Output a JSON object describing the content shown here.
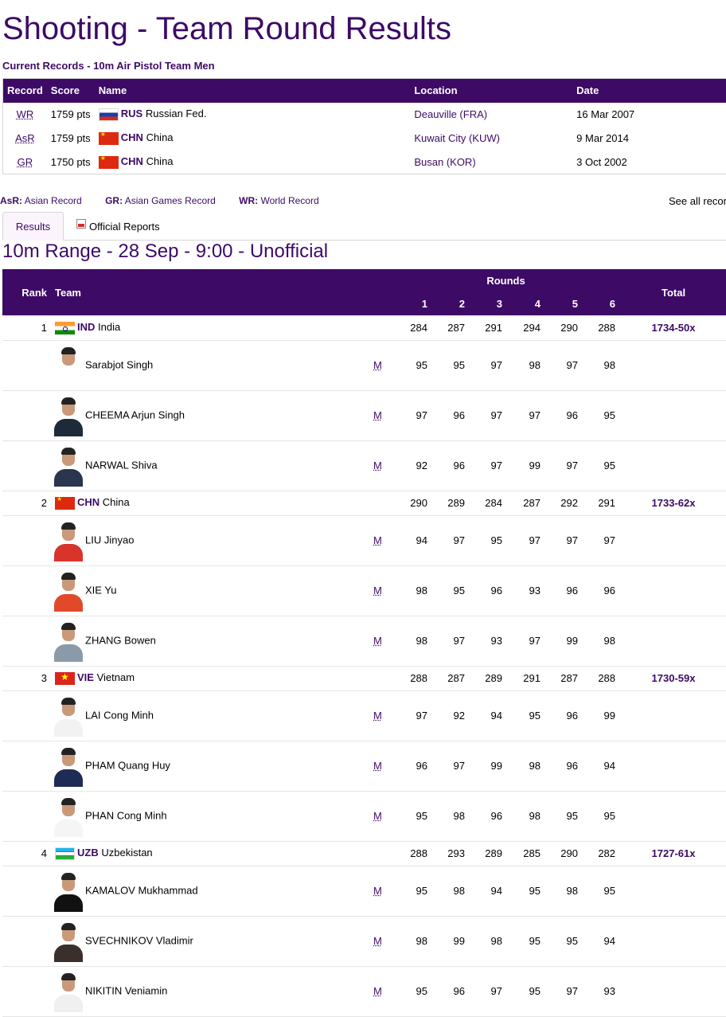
{
  "page_title": "Shooting - Team Round Results",
  "records": {
    "title": "Current Records - 10m Air Pistol Team Men",
    "headers": [
      "Record",
      "Score",
      "Name",
      "Location",
      "Date"
    ],
    "rows": [
      {
        "record": "WR",
        "score": "1759 pts",
        "noc": "RUS",
        "name": "Russian Fed.",
        "location": "Deauville (FRA)",
        "date": "16 Mar 2007"
      },
      {
        "record": "AsR",
        "score": "1759 pts",
        "noc": "CHN",
        "name": "China",
        "location": "Kuwait City (KUW)",
        "date": "9 Mar 2014"
      },
      {
        "record": "GR",
        "score": "1750 pts",
        "noc": "CHN",
        "name": "China",
        "location": "Busan (KOR)",
        "date": "3 Oct 2002"
      }
    ]
  },
  "legend": {
    "items": [
      {
        "code": "AsR:",
        "text": "Asian Record"
      },
      {
        "code": "GR:",
        "text": "Asian Games Record"
      },
      {
        "code": "WR:",
        "text": "World Record"
      }
    ],
    "see_all": "See all records"
  },
  "tabs": {
    "results": "Results",
    "reports": "Official Reports"
  },
  "range_title": "10m Range - 28 Sep - 9:00 - Unofficial",
  "results": {
    "headers": {
      "rank": "Rank",
      "team": "Team",
      "rounds": "Rounds",
      "total": "Total",
      "round_numbers": [
        "1",
        "2",
        "3",
        "4",
        "5",
        "6"
      ]
    },
    "teams": [
      {
        "rank": "1",
        "noc": "IND",
        "name": "India",
        "rounds": [
          "284",
          "287",
          "291",
          "294",
          "290",
          "288"
        ],
        "total": "1734-50x",
        "athletes": [
          {
            "name": "Sarabjot Singh",
            "gender": "M",
            "rounds": [
              "95",
              "95",
              "97",
              "98",
              "97",
              "98"
            ]
          },
          {
            "name": "CHEEMA Arjun Singh",
            "gender": "M",
            "rounds": [
              "97",
              "96",
              "97",
              "97",
              "96",
              "95"
            ]
          },
          {
            "name": "NARWAL Shiva",
            "gender": "M",
            "rounds": [
              "92",
              "96",
              "97",
              "99",
              "97",
              "95"
            ]
          }
        ]
      },
      {
        "rank": "2",
        "noc": "CHN",
        "name": "China",
        "rounds": [
          "290",
          "289",
          "284",
          "287",
          "292",
          "291"
        ],
        "total": "1733-62x",
        "athletes": [
          {
            "name": "LIU Jinyao",
            "gender": "M",
            "rounds": [
              "94",
              "97",
              "95",
              "97",
              "97",
              "97"
            ]
          },
          {
            "name": "XIE Yu",
            "gender": "M",
            "rounds": [
              "98",
              "95",
              "96",
              "93",
              "96",
              "96"
            ]
          },
          {
            "name": "ZHANG Bowen",
            "gender": "M",
            "rounds": [
              "98",
              "97",
              "93",
              "97",
              "99",
              "98"
            ]
          }
        ]
      },
      {
        "rank": "3",
        "noc": "VIE",
        "name": "Vietnam",
        "rounds": [
          "288",
          "287",
          "289",
          "291",
          "287",
          "288"
        ],
        "total": "1730-59x",
        "athletes": [
          {
            "name": "LAI Cong Minh",
            "gender": "M",
            "rounds": [
              "97",
              "92",
              "94",
              "95",
              "96",
              "99"
            ]
          },
          {
            "name": "PHAM Quang Huy",
            "gender": "M",
            "rounds": [
              "96",
              "97",
              "99",
              "98",
              "96",
              "94"
            ]
          },
          {
            "name": "PHAN Cong Minh",
            "gender": "M",
            "rounds": [
              "95",
              "98",
              "96",
              "98",
              "95",
              "95"
            ]
          }
        ]
      },
      {
        "rank": "4",
        "noc": "UZB",
        "name": "Uzbekistan",
        "rounds": [
          "288",
          "293",
          "289",
          "285",
          "290",
          "282"
        ],
        "total": "1727-61x",
        "athletes": [
          {
            "name": "KAMALOV Mukhammad",
            "gender": "M",
            "rounds": [
              "95",
              "98",
              "94",
              "95",
              "98",
              "95"
            ]
          },
          {
            "name": "SVECHNIKOV Vladimir",
            "gender": "M",
            "rounds": [
              "98",
              "99",
              "98",
              "95",
              "95",
              "94"
            ]
          },
          {
            "name": "NIKITIN Veniamin",
            "gender": "M",
            "rounds": [
              "95",
              "96",
              "97",
              "95",
              "97",
              "93"
            ]
          }
        ]
      }
    ]
  },
  "colors": {
    "brand_purple": "#3d0a66",
    "tab_bg": "#fbf4fc",
    "row_border": "#e5e5e5"
  },
  "icons": {
    "report": "pdf-document-icon"
  }
}
